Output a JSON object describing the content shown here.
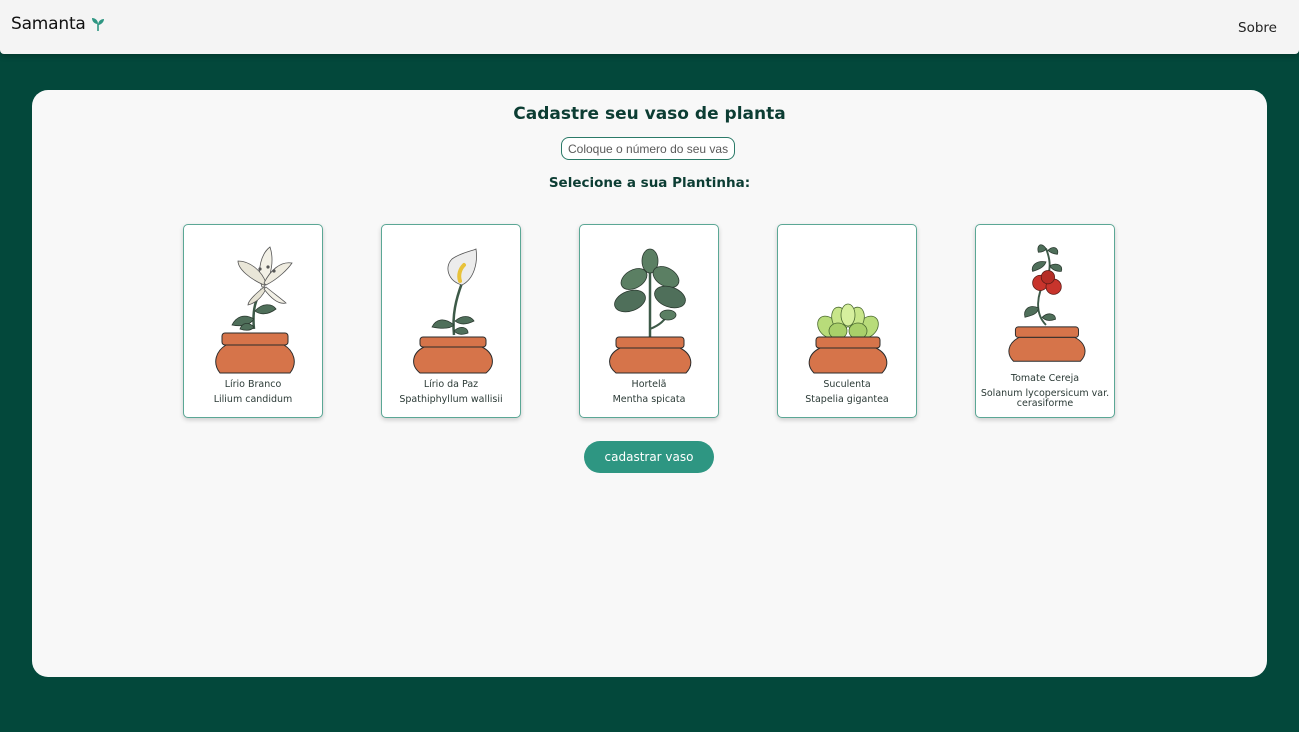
{
  "navbar": {
    "brand": "Samanta",
    "link": "Sobre"
  },
  "form": {
    "title": "Cadastre seu vaso de planta",
    "vase_placeholder": "Coloque o número do seu vaso",
    "subtitle": "Selecione a sua Plantinha:",
    "submit_label": "cadastrar vaso"
  },
  "plants": [
    {
      "name": "Lírio Branco",
      "scientific": "Lilium candidum",
      "icon": "white-lily-icon"
    },
    {
      "name": "Lírio da Paz",
      "scientific": "Spathiphyllum wallisii",
      "icon": "peace-lily-icon"
    },
    {
      "name": "Hortelã",
      "scientific": "Mentha spicata",
      "icon": "mint-icon"
    },
    {
      "name": "Suculenta",
      "scientific": "Stapelia gigantea",
      "icon": "succulent-icon"
    },
    {
      "name": "Tomate Cereja",
      "scientific": "Solanum lycopersicum var. cerasiforme",
      "icon": "cherry-tomato-icon"
    }
  ],
  "colors": {
    "background": "#03483b",
    "accent": "#2e9682",
    "pot": "#d6744a",
    "leaf": "#4f6f5a"
  }
}
